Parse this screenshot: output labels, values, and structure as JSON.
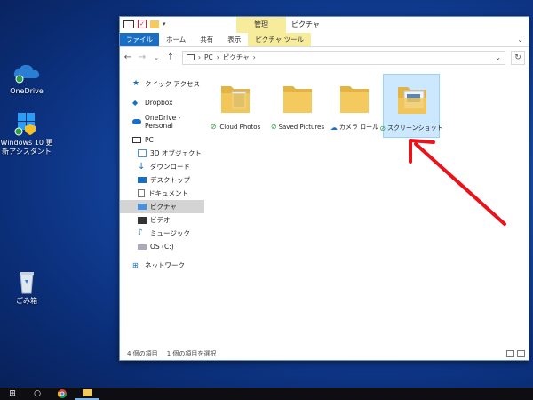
{
  "desktop": {
    "icons": [
      {
        "label": "OneDrive"
      },
      {
        "label": "Windows 10 更新アシスタント"
      },
      {
        "label": "ごみ箱"
      }
    ]
  },
  "window": {
    "manage_tab": "管理",
    "title": "ピクチャ",
    "ribbon_tabs": [
      "ファイル",
      "ホーム",
      "共有",
      "表示",
      "ピクチャ ツール"
    ],
    "address": {
      "path": [
        "PC",
        "ピクチャ"
      ]
    },
    "nav_pane": [
      {
        "label": "クイック アクセス"
      },
      {
        "label": "Dropbox"
      },
      {
        "label": "OneDrive - Personal"
      },
      {
        "label": "PC"
      },
      {
        "label": "3D オブジェクト"
      },
      {
        "label": "ダウンロード"
      },
      {
        "label": "デスクトップ"
      },
      {
        "label": "ドキュメント"
      },
      {
        "label": "ピクチャ"
      },
      {
        "label": "ビデオ"
      },
      {
        "label": "ミュージック"
      },
      {
        "label": "OS (C:)"
      },
      {
        "label": "ネットワーク"
      }
    ],
    "folders": [
      {
        "label": "iCloud Photos",
        "status": "synced"
      },
      {
        "label": "Saved Pictures",
        "status": "synced"
      },
      {
        "label": "カメラ ロール",
        "status": "cloud"
      },
      {
        "label": "スクリーンショット",
        "status": "synced"
      }
    ],
    "status": {
      "item_count": "4 個の項目",
      "selected": "1 個の項目を選択"
    }
  },
  "colors": {
    "accent": "#1a6fc4",
    "picture_tools": "#f7ec9c",
    "selection": "#cce8ff",
    "annotation_arrow": "#e8141c",
    "folder": "#f4c95d"
  }
}
